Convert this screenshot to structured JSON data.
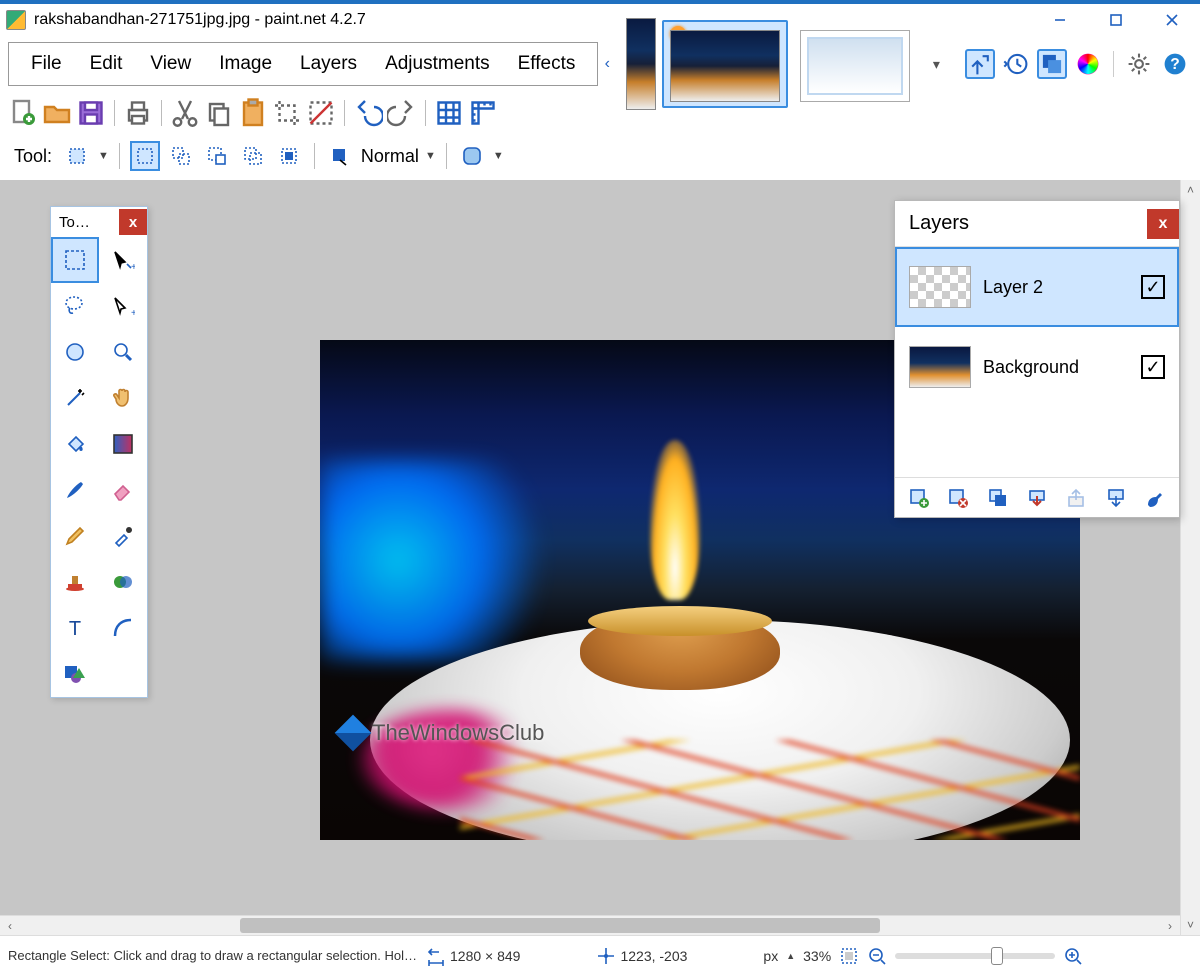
{
  "window": {
    "title": "rakshabandhan-271751jpg.jpg - paint.net 4.2.7"
  },
  "menu": {
    "items": [
      "File",
      "Edit",
      "View",
      "Image",
      "Layers",
      "Adjustments",
      "Effects"
    ]
  },
  "thumbnails": {
    "modified_badge": "*"
  },
  "tooloptions": {
    "label": "Tool:",
    "mode_label": "Normal"
  },
  "toolspanel": {
    "title": "To…"
  },
  "layerspanel": {
    "title": "Layers",
    "items": [
      {
        "name": "Layer 2",
        "checked": true,
        "selected": true,
        "thumb": "checker"
      },
      {
        "name": "Background",
        "checked": true,
        "selected": false,
        "thumb": "bgimg"
      }
    ]
  },
  "watermark": {
    "text": "TheWindowsClub"
  },
  "status": {
    "hint": "Rectangle Select: Click and drag to draw a rectangular selection. Hol…",
    "dims": "1280 × 849",
    "cursor": "1223, -203",
    "units": "px",
    "zoom": "33%"
  }
}
